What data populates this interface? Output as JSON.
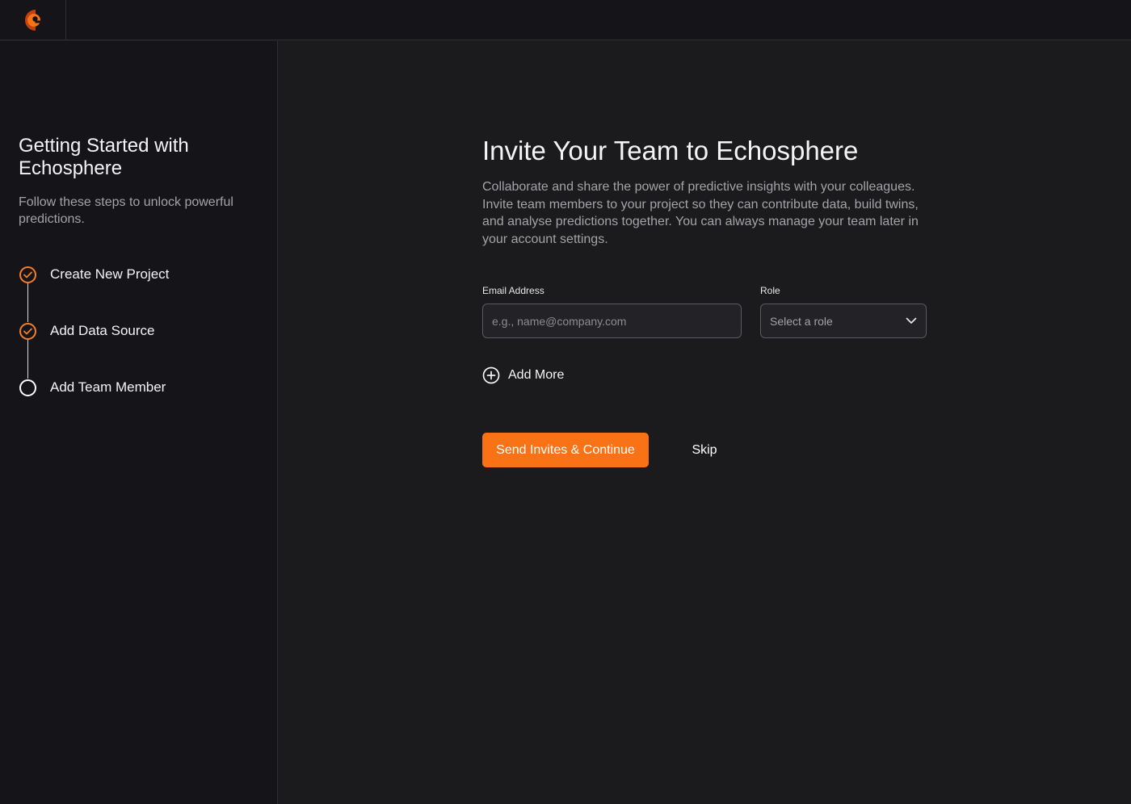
{
  "brand": {
    "logo_icon": "echosphere-logo-icon",
    "accent": "#f97316"
  },
  "sidebar": {
    "title": "Getting Started with Echosphere",
    "subtitle": "Follow these steps to unlock powerful predictions.",
    "steps": [
      {
        "label": "Create New Project",
        "status": "done",
        "icon": "check-circle-icon"
      },
      {
        "label": "Add Data Source",
        "status": "done",
        "icon": "check-circle-icon"
      },
      {
        "label": "Add Team Member",
        "status": "pending",
        "icon": "empty-circle-icon"
      }
    ]
  },
  "main": {
    "title": "Invite Your Team to Echosphere",
    "description": "Collaborate and share the power of predictive insights with your colleagues. Invite team members to your project so they can contribute data, build twins, and analyse predictions together. You can always manage your team later in your account settings.",
    "email": {
      "label": "Email Address",
      "placeholder": "e.g., name@company.com",
      "value": ""
    },
    "role": {
      "label": "Role",
      "placeholder": "Select a role",
      "icon": "chevron-down-icon"
    },
    "add_more": {
      "label": "Add More",
      "icon": "plus-circle-icon"
    },
    "primary_button": "Send Invites & Continue",
    "secondary_button": "Skip"
  }
}
